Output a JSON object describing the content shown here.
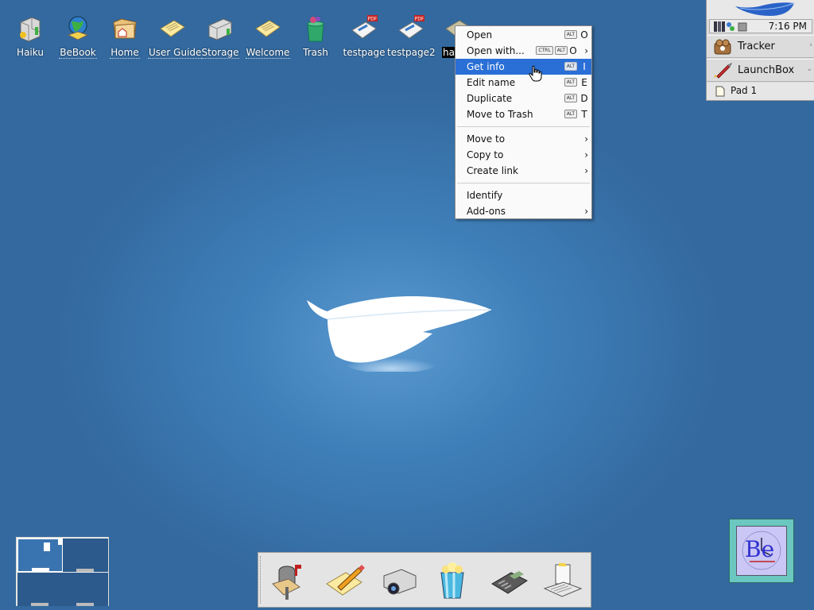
{
  "desktop": {
    "icons": [
      {
        "label": "Haiku"
      },
      {
        "label": "BeBook"
      },
      {
        "label": "Home"
      },
      {
        "label": "User Guide"
      },
      {
        "label": "Storage"
      },
      {
        "label": "Welcome"
      },
      {
        "label": "Trash"
      },
      {
        "label": "testpage"
      },
      {
        "label": "testpage2"
      },
      {
        "label": "ha"
      }
    ]
  },
  "context_menu": {
    "items": [
      {
        "label": "Open",
        "mods": [
          "ALT"
        ],
        "key": "O"
      },
      {
        "label": "Open with...",
        "mods": [
          "CTRL",
          "ALT"
        ],
        "key": "O"
      },
      {
        "label": "Get info",
        "mods": [
          "ALT"
        ],
        "key": "I"
      },
      {
        "label": "Edit name",
        "mods": [
          "ALT"
        ],
        "key": "E"
      },
      {
        "label": "Duplicate",
        "mods": [
          "ALT"
        ],
        "key": "D"
      },
      {
        "label": "Move to Trash",
        "mods": [
          "ALT"
        ],
        "key": "T"
      },
      {
        "label": "Move to"
      },
      {
        "label": "Copy to"
      },
      {
        "label": "Create link"
      },
      {
        "label": "Identify"
      },
      {
        "label": "Add-ons"
      }
    ],
    "highlighted": "Get info"
  },
  "deskbar": {
    "clock": "7:16 PM",
    "tracker_label": "Tracker",
    "launchbox_label": "LaunchBox",
    "pad_label": "Pad 1"
  },
  "colors": {
    "desktop": "#3f7fb9",
    "menu_highlight": "#2a6fd6",
    "workspace_active": "#3a74b0",
    "workspace_inactive": "#2c5a8c"
  }
}
